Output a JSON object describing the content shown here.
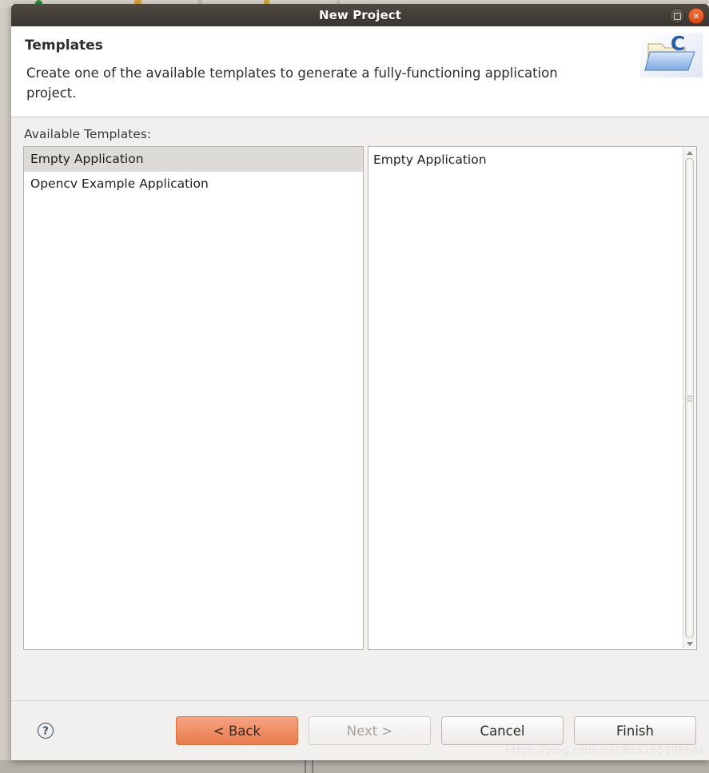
{
  "window": {
    "title": "New Project",
    "maximize_icon": "maximize-icon",
    "close_icon": "close-icon"
  },
  "header": {
    "title": "Templates",
    "description": "Create one of the available templates to generate a fully-functioning application project.",
    "icon": "c-project-folder-icon"
  },
  "body": {
    "available_label": "Available Templates:",
    "templates": [
      {
        "label": "Empty Application",
        "selected": true
      },
      {
        "label": "Opencv Example Application",
        "selected": false
      }
    ],
    "description_panel": {
      "text": "Empty Application",
      "scrollbar": {
        "up_arrow": "scroll-up-arrow-icon",
        "down_arrow": "scroll-down-arrow-icon"
      }
    }
  },
  "footer": {
    "help_icon": "help-question-icon",
    "buttons": [
      {
        "label": "< Back",
        "state": "primary"
      },
      {
        "label": "Next >",
        "state": "disabled"
      },
      {
        "label": "Cancel",
        "state": "normal"
      },
      {
        "label": "Finish",
        "state": "normal"
      }
    ]
  },
  "watermark": "https://blog.csdn.net/bbs165198646",
  "colors": {
    "titlebar": "#433d37",
    "accent_orange": "#e97c4f",
    "dialog_bg": "#f1f0ee",
    "selection": "#dddbd7"
  }
}
